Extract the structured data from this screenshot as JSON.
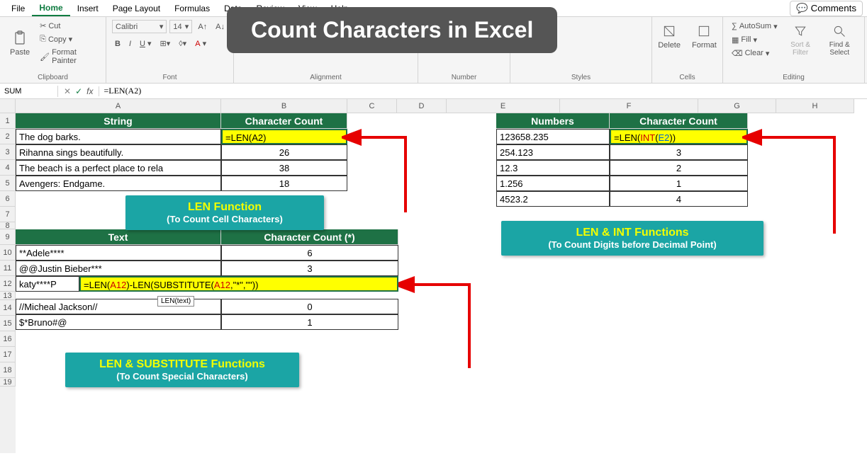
{
  "menu": {
    "file": "File",
    "home": "Home",
    "insert": "Insert",
    "pageLayout": "Page Layout",
    "formulas": "Formulas",
    "data": "Data",
    "review": "Review",
    "view": "View",
    "help": "Help",
    "comments": "Comments"
  },
  "ribbon": {
    "clipboard": {
      "label": "Clipboard",
      "paste": "Paste",
      "cut": "Cut",
      "copy": "Copy",
      "formatPainter": "Format Painter"
    },
    "font": {
      "label": "Font",
      "name": "Calibri",
      "size": "14"
    },
    "alignment": {
      "label": "Alignment"
    },
    "number": {
      "label": "Number"
    },
    "styles": {
      "label": "Styles"
    },
    "cells": {
      "label": "Cells",
      "delete": "Delete",
      "format": "Format"
    },
    "editing": {
      "label": "Editing",
      "autosum": "AutoSum",
      "fill": "Fill",
      "clear": "Clear",
      "sortFilter": "Sort & Filter",
      "findSelect": "Find & Select"
    }
  },
  "formulaBar": {
    "nameBox": "SUM",
    "formula": "=LEN(A2)"
  },
  "columns": [
    "A",
    "B",
    "C",
    "D",
    "E",
    "F",
    "G",
    "H"
  ],
  "rows": [
    "1",
    "2",
    "3",
    "4",
    "5",
    "6",
    "7",
    "8",
    "9",
    "10",
    "11",
    "12",
    "13",
    "14",
    "15",
    "16",
    "17",
    "18",
    "19"
  ],
  "table1": {
    "headerA": "String",
    "headerB": "Character Count",
    "rows": [
      {
        "a": "The dog barks.",
        "b": "=LEN(A2)"
      },
      {
        "a": "Rihanna sings beautifully.",
        "b": "26"
      },
      {
        "a": "The beach is a perfect place to rela",
        "b": "38"
      },
      {
        "a": "Avengers: Endgame.",
        "b": "18"
      }
    ]
  },
  "table2": {
    "headerE": "Numbers",
    "headerF": "Character Count",
    "rows": [
      {
        "e": "123658.235",
        "f": "=LEN(INT(E2))"
      },
      {
        "e": "254.123",
        "f": "3"
      },
      {
        "e": "12.3",
        "f": "2"
      },
      {
        "e": "1.256",
        "f": "1"
      },
      {
        "e": "4523.2",
        "f": "4"
      }
    ]
  },
  "table3": {
    "headerA": "Text",
    "headerB": "Character Count (*)",
    "rows": [
      {
        "a": "**Adele****",
        "b": "6"
      },
      {
        "a": " @@Justin Bieber***",
        "b": "3"
      },
      {
        "a": "katy****P",
        "b": "=LEN(A12)-LEN(SUBSTITUTE(A12,\"*\",\"\"))"
      },
      {
        "a": "//Micheal Jackson//",
        "b": "0"
      },
      {
        "a": "$*Bruno#@",
        "b": "1"
      }
    ]
  },
  "tooltip": "LEN(text)",
  "overlayTitle": "Count Characters in Excel",
  "callouts": {
    "len": {
      "title": "LEN Function",
      "sub": "(To Count Cell Characters)"
    },
    "lenint": {
      "title": "LEN & INT Functions",
      "sub": "(To Count Digits before Decimal Point)"
    },
    "lensub": {
      "title": "LEN & SUBSTITUTE Functions",
      "sub": "(To Count Special Characters)"
    }
  }
}
